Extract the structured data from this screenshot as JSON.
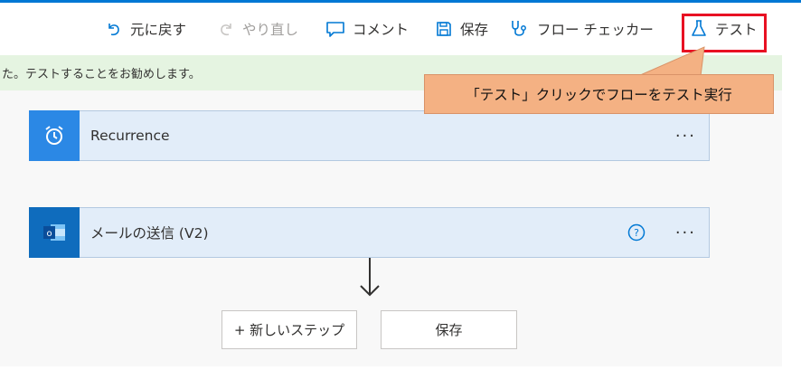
{
  "toolbar": {
    "undo_label": "元に戻す",
    "redo_label": "やり直し",
    "comment_label": "コメント",
    "save_label": "保存",
    "flow_checker_label": "フロー チェッカー",
    "test_label": "テスト"
  },
  "banner": {
    "text": "た。テストすることをお勧めします。"
  },
  "callout": {
    "text": "「テスト」クリックでフローをテスト実行"
  },
  "steps": [
    {
      "title": "Recurrence",
      "icon": "alarm-clock-icon"
    },
    {
      "title": "メールの送信 (V2)",
      "icon": "outlook-icon"
    }
  ],
  "step_menu_label": "···",
  "buttons": {
    "new_step_label": "+ 新しいステップ",
    "save_label": "保存"
  },
  "colors": {
    "accent": "#0078d4",
    "highlight_border": "#e81123",
    "callout_fill": "#f4b183",
    "banner_bg": "#e5f4e1",
    "card_bg": "#e2edf9"
  }
}
